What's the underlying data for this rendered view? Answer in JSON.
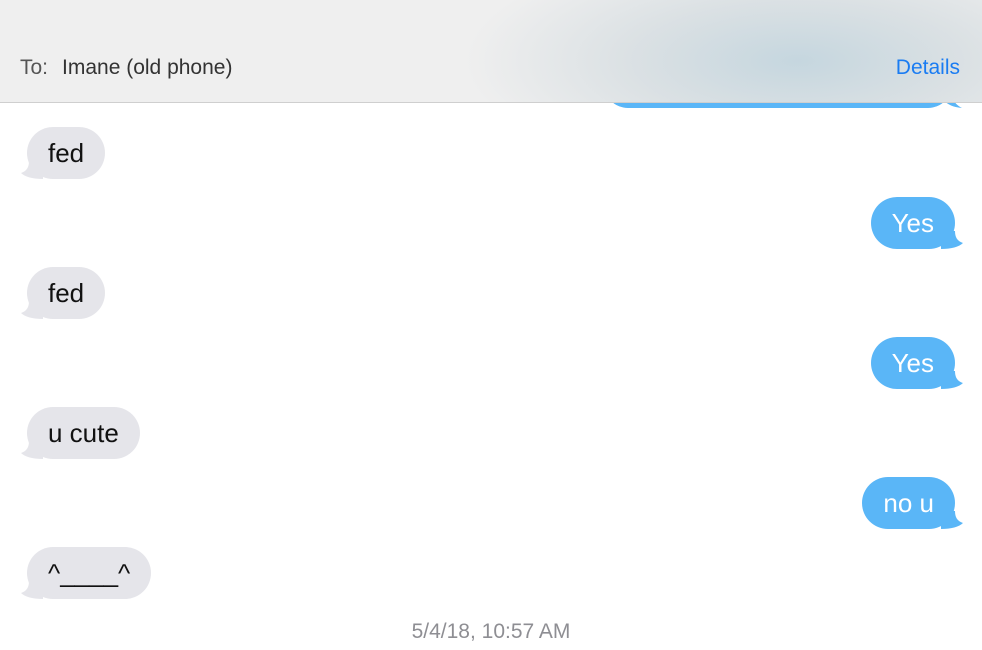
{
  "header": {
    "to_label": "To:",
    "recipient": "Imane (old phone)",
    "details_label": "Details"
  },
  "colors": {
    "incoming_bubble": "#e5e5ea",
    "outgoing_bubble": "#5ab6f7",
    "link": "#1a7cf2",
    "timestamp": "#8e8e93"
  },
  "messages": [
    {
      "direction": "incoming",
      "text": "fed"
    },
    {
      "direction": "outgoing",
      "text": "Yes"
    },
    {
      "direction": "incoming",
      "text": "fed"
    },
    {
      "direction": "outgoing",
      "text": "Yes"
    },
    {
      "direction": "incoming",
      "text": "u cute"
    },
    {
      "direction": "outgoing",
      "text": "no u"
    },
    {
      "direction": "incoming",
      "text": "^____^"
    }
  ],
  "timestamp": "5/4/18, 10:57 AM"
}
